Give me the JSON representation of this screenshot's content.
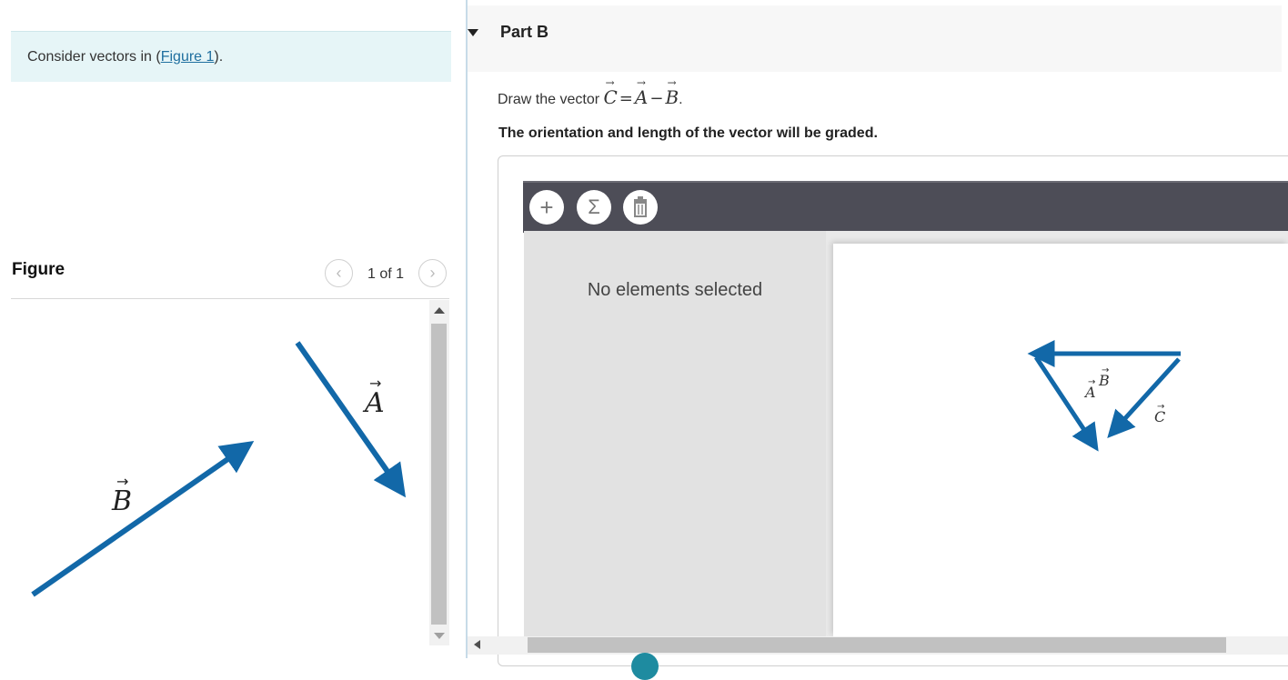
{
  "prompt": {
    "text_before": "Consider vectors in (",
    "link": "Figure 1",
    "text_after": ")."
  },
  "figure": {
    "heading": "Figure",
    "pager": "1 of 1",
    "prev_glyph": "‹",
    "next_glyph": "›",
    "labels": {
      "A": "A",
      "B": "B"
    }
  },
  "part": {
    "title": "Part B",
    "question_prefix": "Draw the vector ",
    "vec_c": "C",
    "eq": "=",
    "vec_a": "A",
    "minus": "−",
    "vec_b": "B",
    "period": ".",
    "grading_note": "The orientation and length of the vector will be graded."
  },
  "toolbar": {
    "add_glyph": "+",
    "sum_glyph": "Σ",
    "delete_icon": "trash-icon"
  },
  "side_panel": {
    "message": "No elements selected"
  },
  "canvas": {
    "labels": {
      "A": "A",
      "B": "B",
      "C": "C"
    }
  },
  "colors": {
    "vector": "#1268a8",
    "prompt_bg": "#e6f5f7",
    "toolbar_bg": "#4d4d57"
  }
}
